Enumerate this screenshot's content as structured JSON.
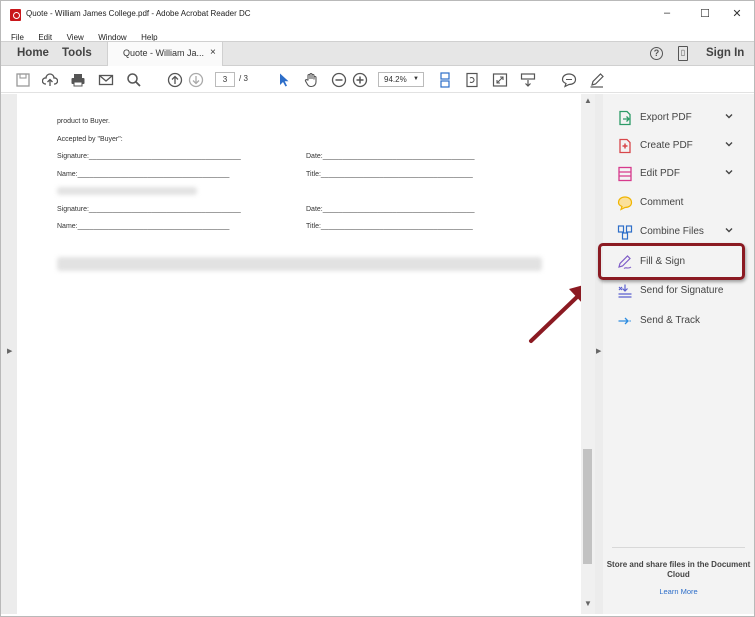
{
  "window": {
    "title": "Quote - William James College.pdf - Adobe Acrobat Reader DC",
    "controls": {
      "minimize": "–",
      "maximize": "☐",
      "close": "✕"
    }
  },
  "menu": [
    "File",
    "Edit",
    "View",
    "Window",
    "Help"
  ],
  "tabs": {
    "home": "Home",
    "tools": "Tools",
    "document": "Quote - William Ja...",
    "document_close": "×",
    "help": "?",
    "sign_in": "Sign In"
  },
  "toolbar": {
    "page_current": "3",
    "page_total": "/ 3",
    "zoom": "94.2%"
  },
  "document": {
    "lines": [
      "product to Buyer.",
      "Accepted by \"Buyer\":",
      "Signature:_______________________________________",
      "Date:_______________________________________",
      "Name:_______________________________________",
      "Title:_______________________________________",
      "Signature:_______________________________________",
      "Date:_______________________________________",
      "Name:_______________________________________",
      "Title:_______________________________________"
    ]
  },
  "right_panel": {
    "items": [
      {
        "label": "Export PDF",
        "icon": "export-pdf-icon",
        "color": "#2d9b67",
        "chevron": true
      },
      {
        "label": "Create PDF",
        "icon": "create-pdf-icon",
        "color": "#d8474b",
        "chevron": true
      },
      {
        "label": "Edit PDF",
        "icon": "edit-pdf-icon",
        "color": "#d73a8c",
        "chevron": true
      },
      {
        "label": "Comment",
        "icon": "comment-icon",
        "color": "#f0b400",
        "chevron": false
      },
      {
        "label": "Combine Files",
        "icon": "combine-files-icon",
        "color": "#2d6ec9",
        "chevron": true
      },
      {
        "label": "Fill & Sign",
        "icon": "fill-sign-icon",
        "color": "#7e5bc7",
        "chevron": false
      },
      {
        "label": "Send for Signature",
        "icon": "send-signature-icon",
        "color": "#5a5fcf",
        "chevron": false
      },
      {
        "label": "Send & Track",
        "icon": "send-track-icon",
        "color": "#2d8ce0",
        "chevron": false
      }
    ],
    "cloud_title": "Store and share files in the Document Cloud",
    "learn_more": "Learn More"
  },
  "highlight_color": "#8b1a22"
}
